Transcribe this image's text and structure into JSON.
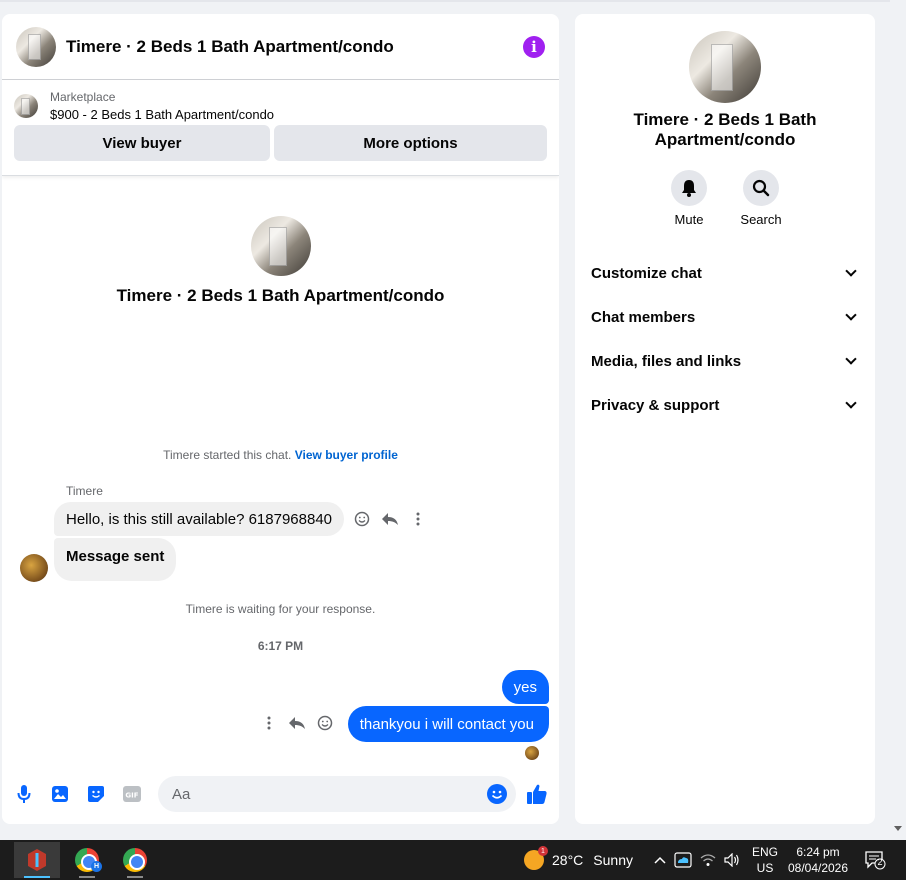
{
  "chat": {
    "title": "Timere · 2 Beds 1 Bath Apartment/condo",
    "listing": {
      "source": "Marketplace",
      "price_title": "$900 - 2 Beds 1 Bath Apartment/condo",
      "view_buyer_label": "View buyer",
      "more_options_label": "More options"
    },
    "hero_title": "Timere · 2 Beds 1 Bath Apartment/condo",
    "started_text": "Timere started this chat.",
    "view_profile_link": "View buyer profile",
    "sender_name": "Timere",
    "messages_in": [
      "Hello, is this still available? 6187968840",
      "Message sent"
    ],
    "waiting_text": "Timere is waiting for your response.",
    "timestamp": "6:17 PM",
    "messages_out": [
      "yes",
      "thankyou i will contact you"
    ],
    "composer_placeholder": "Aa"
  },
  "info_panel": {
    "title": "Timere · 2 Beds 1 Bath Apartment/condo",
    "mute_label": "Mute",
    "search_label": "Search",
    "sections": [
      "Customize chat",
      "Chat members",
      "Media, files and links",
      "Privacy & support"
    ]
  },
  "taskbar": {
    "weather_temp": "28°C",
    "weather_desc": "Sunny",
    "weather_badge": "1",
    "lang_line1": "ENG",
    "lang_line2": "US",
    "time": "6:24 pm",
    "date": "08/04/2026",
    "notification_count": "2",
    "chrome_badge": "H"
  },
  "colors": {
    "accent": "#0866ff",
    "info_icon": "#a020f0",
    "bubble_in": "#f0f0f0",
    "link": "#0064d1"
  }
}
